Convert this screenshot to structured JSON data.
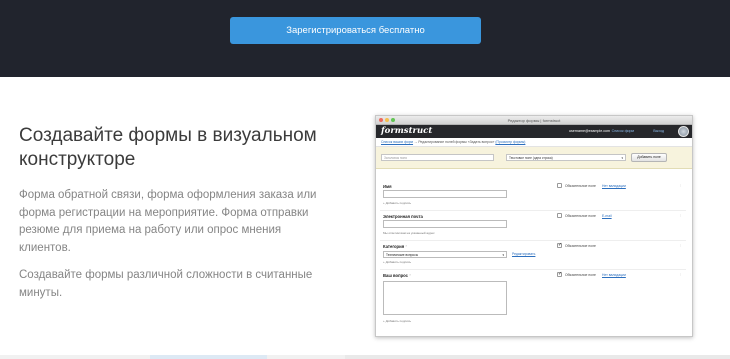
{
  "hero": {
    "cta_label": "Зарегистрироваться бесплатно"
  },
  "feature": {
    "heading": "Создавайте формы в визуальном конструкторе",
    "paragraph1": "Форма обратной связи, форма оформления заказа или форма регистрации на мероприятие. Форма отправки резюме для приема на работу или опрос мнения клиентов.",
    "paragraph2": "Создавайте формы различной сложности в считанные минуты."
  },
  "mockup": {
    "window_title": "Редактор формы | formstruct",
    "logo": "formstruct",
    "user_email": "username@example.com",
    "user_links": [
      "Список форм",
      "Выход"
    ],
    "breadcrumbs": {
      "link1": "Список ваших форм",
      "text": "→ Редактирование полей формы «Задать вопрос»",
      "link2": "(Просмотр формы)"
    },
    "toolbar": {
      "field_name_placeholder": "Заголовок поля",
      "field_type": "Текстовое поле (одна строка)",
      "add_button": "Добавить поле"
    },
    "fields": [
      {
        "label": "Имя",
        "required": false,
        "required_label": "Обязательное поле",
        "link": "Нет валидации",
        "hint": "+ Добавить подпись"
      },
      {
        "label": "Электронная почта",
        "required": false,
        "required_label": "Обязательное поле",
        "link": "E-mail",
        "hint": "Мы ответим вам на указанный адрес"
      },
      {
        "label": "Категория",
        "required": true,
        "required_label": "Обязательное поле",
        "select_value": "Технические вопросы",
        "configure": "Редактировать",
        "hint": "+ Добавить подпись"
      },
      {
        "label": "Ваш вопрос",
        "required": true,
        "required_label": "Обязательное поле",
        "link": "Нет валидации",
        "hint": "+ Добавить подпись"
      }
    ]
  }
}
